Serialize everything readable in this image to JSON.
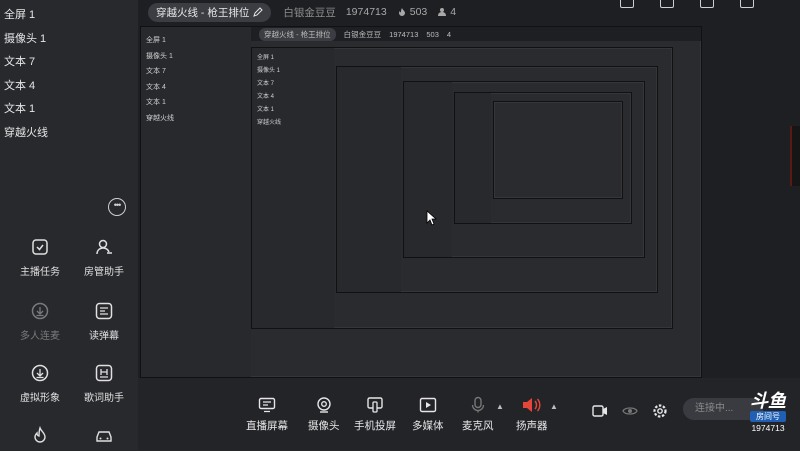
{
  "sources": [
    "全屏 1",
    "摄像头 1",
    "文本 7",
    "文本 4",
    "文本 1",
    "穿越火线"
  ],
  "left_tools": [
    {
      "label": "主播任务",
      "icon": "task-icon",
      "enabled": true
    },
    {
      "label": "房管助手",
      "icon": "manager-icon",
      "enabled": true
    },
    {
      "label": "多人连麦",
      "icon": "download-icon",
      "enabled": false
    },
    {
      "label": "读弹幕",
      "icon": "danmaku-icon",
      "enabled": true
    },
    {
      "label": "虚拟形象",
      "icon": "download-icon",
      "enabled": true
    },
    {
      "label": "歌词助手",
      "icon": "lyrics-icon",
      "enabled": true
    }
  ],
  "header": {
    "room_title": "穿越火线 - 枪王排位",
    "bean_label": "白银金豆豆",
    "room_id": "1974713",
    "heat": "503",
    "viewers": "4"
  },
  "bottom_tools": [
    {
      "label": "直播屏幕",
      "icon": "screen-icon"
    },
    {
      "label": "摄像头",
      "icon": "camera-icon"
    },
    {
      "label": "手机投屏",
      "icon": "phone-cast-icon"
    },
    {
      "label": "多媒体",
      "icon": "media-icon"
    },
    {
      "label": "麦克风",
      "icon": "microphone-icon"
    },
    {
      "label": "扬声器",
      "icon": "speaker-icon"
    }
  ],
  "connect_label": "连接中...",
  "brand": {
    "logo_text": "斗鱼",
    "badge": "房间号",
    "room_id": "1974713"
  },
  "colors": {
    "accent_red": "#e4463a",
    "panel": "#28292d",
    "background": "#1e1f23"
  }
}
